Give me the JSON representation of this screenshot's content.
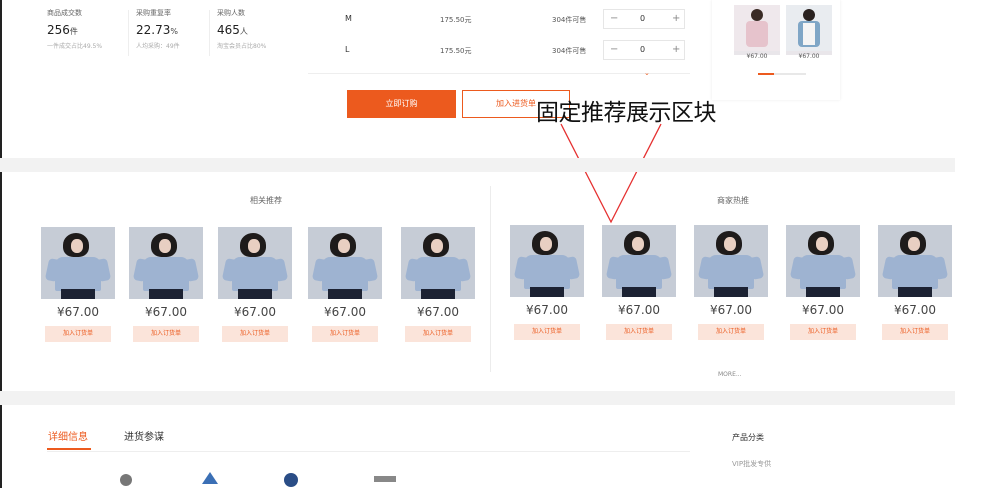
{
  "stats": [
    {
      "label": "商品成交数",
      "value": "256",
      "unit": "件",
      "sub": "一件成交占比49.5%"
    },
    {
      "label": "采购重复率",
      "value": "22.73",
      "unit": "%",
      "sub": "人均采购：49件"
    },
    {
      "label": "采购人数",
      "value": "465",
      "unit": "人",
      "sub": "淘宝会员占比80%"
    }
  ],
  "sku_rows": [
    {
      "size": "M",
      "price": "175.50元",
      "stock": "304件可售",
      "minus": "−",
      "qty": "0",
      "plus": "+"
    },
    {
      "size": "L",
      "price": "175.50元",
      "stock": "304件可售",
      "minus": "−",
      "qty": "0",
      "plus": "+"
    }
  ],
  "buttons": {
    "buy_now": "立即订购",
    "add_to_list": "加入进货单"
  },
  "annotation": "固定推荐展示区块",
  "mini_thumbs": [
    {
      "price": "¥67.00"
    },
    {
      "price": "¥67.00"
    }
  ],
  "sections": {
    "related_title": "相关推荐",
    "hot_title": "商家热推",
    "more": "MORE..."
  },
  "related_products": [
    {
      "price": "¥67.00",
      "add": "加入订货单"
    },
    {
      "price": "¥67.00",
      "add": "加入订货单"
    },
    {
      "price": "¥67.00",
      "add": "加入订货单"
    },
    {
      "price": "¥67.00",
      "add": "加入订货单"
    },
    {
      "price": "¥67.00",
      "add": "加入订货单"
    }
  ],
  "hot_products": [
    {
      "price": "¥67.00",
      "add": "加入订货单"
    },
    {
      "price": "¥67.00",
      "add": "加入订货单"
    },
    {
      "price": "¥67.00",
      "add": "加入订货单"
    },
    {
      "price": "¥67.00",
      "add": "加入订货单"
    },
    {
      "price": "¥67.00",
      "add": "加入订货单"
    }
  ],
  "tabs": [
    {
      "label": "详细信息",
      "active": true
    },
    {
      "label": "进货参谋",
      "active": false
    }
  ],
  "category": {
    "title": "产品分类",
    "item": "VIP批发专供"
  },
  "colors": {
    "accent": "#ec5a1e",
    "accent_light": "#fbe4da",
    "band": "#f2f2f2",
    "annotation_line": "#e53030"
  }
}
